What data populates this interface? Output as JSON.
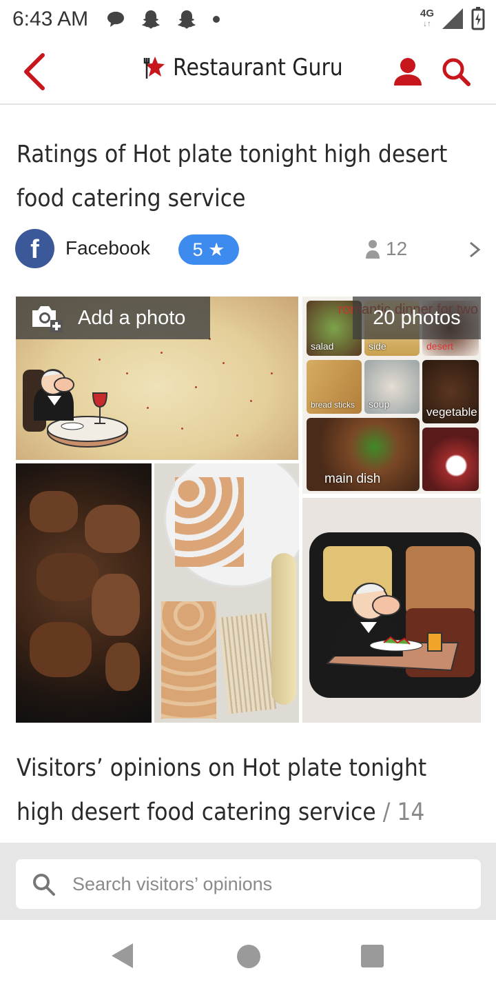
{
  "status_bar": {
    "time": "6:43 AM",
    "network": "4G",
    "icons": [
      "message-icon",
      "snapchat-icon",
      "snapchat-icon",
      "dot-icon",
      "signal-icon",
      "battery-icon"
    ]
  },
  "header": {
    "brand_name": "Restaurant Guru",
    "accent_color": "#c8161d"
  },
  "page_title": "Ratings of Hot plate tonight high desert food catering service",
  "rating_row": {
    "source": "Facebook",
    "source_initial": "f",
    "rating": "5 ★",
    "reviews_count": "12",
    "badge_color": "#3d8bef"
  },
  "gallery": {
    "add_photo_label": "Add a photo",
    "photos_count_label": "20 photos",
    "collage_banner": "romantic dinner for two",
    "collage_labels": [
      "salad",
      "side",
      "desert",
      "bread sticks",
      "soup",
      "vegetable",
      "main dish"
    ]
  },
  "visitors": {
    "title": "Visitors’ opinions on Hot plate tonight high desert food catering service",
    "count": "/ 14"
  },
  "search": {
    "placeholder": "Search visitors’ opinions"
  }
}
